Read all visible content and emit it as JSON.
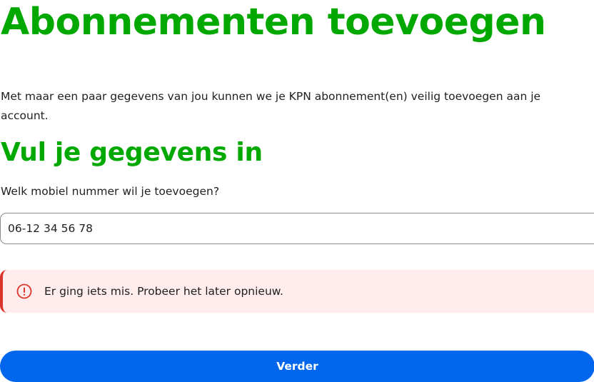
{
  "page": {
    "title": "Abonnementen toevoegen",
    "intro": "Met maar een paar gegevens van jou kunnen we je KPN abonnement(en) veilig toevoegen aan je account.",
    "subtitle": "Vul je gegevens in"
  },
  "form": {
    "phone_label": "Welk mobiel nummer wil je toevoegen?",
    "phone_value": "06-12 34 56 78"
  },
  "alert": {
    "icon": "error-circle-icon",
    "message": "Er ging iets mis. Probeer het later opnieuw."
  },
  "actions": {
    "next_label": "Verder"
  },
  "colors": {
    "brand_green": "#00a800",
    "primary_blue": "#0066ee",
    "error_red": "#d9352b",
    "error_bg": "#ffecec"
  }
}
